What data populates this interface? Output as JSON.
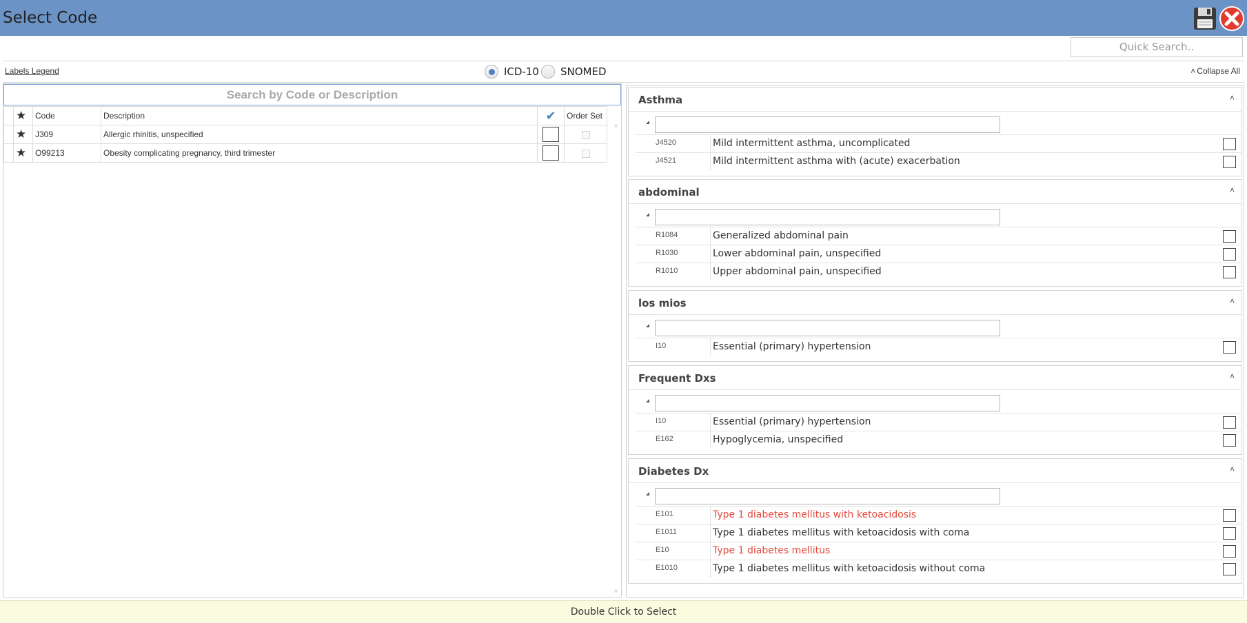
{
  "window": {
    "title": "Select Code"
  },
  "quick_search": {
    "placeholder": "Quick Search.."
  },
  "toolbar": {
    "labels_legend": "Labels Legend",
    "radio_icd10": "ICD-10",
    "radio_snomed": "SNOMED",
    "selected_coding": "ICD-10",
    "collapse_all": "Collapse All"
  },
  "search": {
    "placeholder": "Search by Code or Description"
  },
  "grid": {
    "headers": {
      "code": "Code",
      "description": "Description",
      "order_set": "Order Set"
    },
    "rows": [
      {
        "code": "J309",
        "description": "Allergic rhinitis, unspecified",
        "favorite": true,
        "checked": false,
        "order_set": false
      },
      {
        "code": "O99213",
        "description": "Obesity complicating pregnancy, third trimester",
        "favorite": true,
        "checked": false,
        "order_set": false
      }
    ]
  },
  "groups": [
    {
      "title": "Asthma",
      "items": [
        {
          "code": "J4520",
          "description": "Mild intermittent asthma, uncomplicated",
          "red": false
        },
        {
          "code": "J4521",
          "description": "Mild intermittent asthma with (acute) exacerbation",
          "red": false
        }
      ]
    },
    {
      "title": "abdominal",
      "items": [
        {
          "code": "R1084",
          "description": "Generalized abdominal pain",
          "red": false
        },
        {
          "code": "R1030",
          "description": "Lower abdominal pain, unspecified",
          "red": false
        },
        {
          "code": "R1010",
          "description": "Upper abdominal pain, unspecified",
          "red": false
        }
      ]
    },
    {
      "title": "los mios",
      "items": [
        {
          "code": "I10",
          "description": "Essential (primary) hypertension",
          "red": false
        }
      ]
    },
    {
      "title": "Frequent Dxs",
      "items": [
        {
          "code": "I10",
          "description": "Essential (primary) hypertension",
          "red": false
        },
        {
          "code": "E162",
          "description": "Hypoglycemia, unspecified",
          "red": false
        }
      ]
    },
    {
      "title": "Diabetes Dx",
      "items": [
        {
          "code": "E101",
          "description": "Type 1 diabetes mellitus with ketoacidosis",
          "red": true
        },
        {
          "code": "E1011",
          "description": "Type 1 diabetes mellitus with ketoacidosis with coma",
          "red": false
        },
        {
          "code": "E10",
          "description": "Type 1 diabetes mellitus",
          "red": true
        },
        {
          "code": "E1010",
          "description": "Type 1 diabetes mellitus with ketoacidosis without coma",
          "red": false
        }
      ]
    }
  ],
  "status": {
    "hint": "Double Click to Select"
  },
  "colors": {
    "titlebar": "#6b93c6",
    "accent": "#4a82c3",
    "star": "#f6c800",
    "highlight_text": "#e34a3c",
    "status_bg": "#fbfbe0"
  }
}
